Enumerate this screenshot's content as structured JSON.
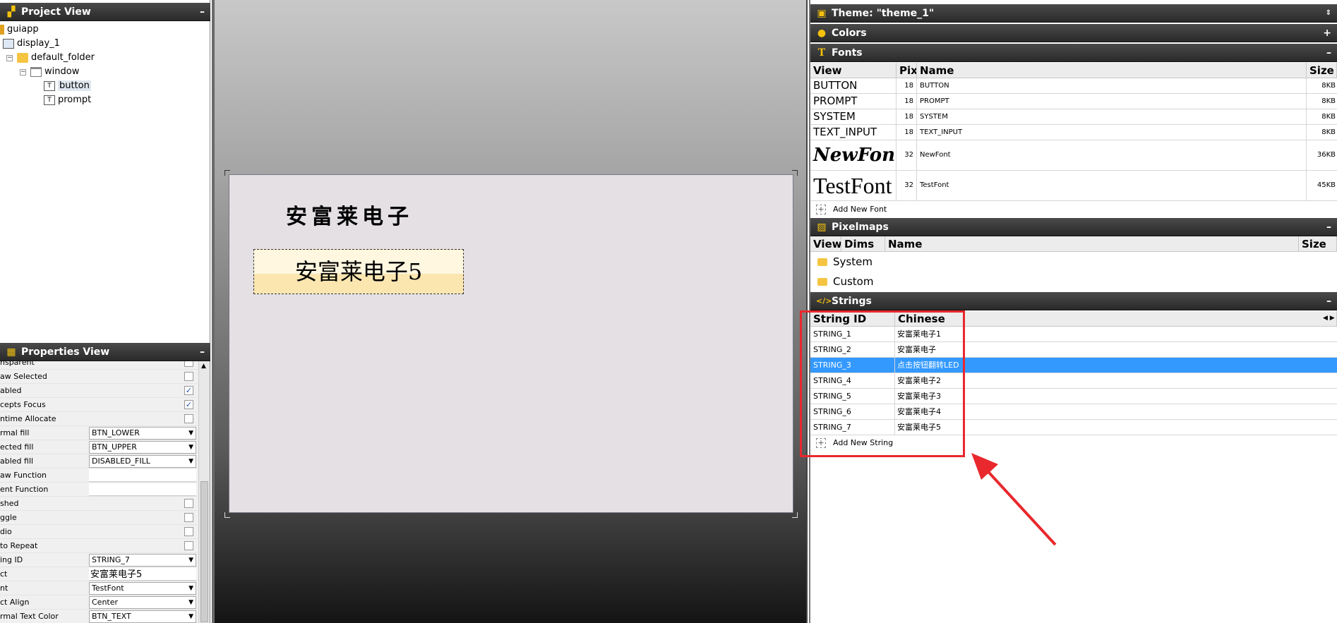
{
  "project_view": {
    "title": "Project View",
    "collapse": "–",
    "tree": [
      {
        "label": "guiapp"
      },
      {
        "label": "display_1"
      },
      {
        "label": "default_folder"
      },
      {
        "label": "window"
      },
      {
        "label": "button"
      },
      {
        "label": "prompt"
      }
    ]
  },
  "properties_view": {
    "title": "Properties View",
    "collapse": "–",
    "rows": [
      {
        "label": "nsparent",
        "type": "check",
        "checked": false
      },
      {
        "label": "aw Selected",
        "type": "check",
        "checked": false
      },
      {
        "label": "abled",
        "type": "check",
        "checked": true
      },
      {
        "label": "cepts Focus",
        "type": "check",
        "checked": true
      },
      {
        "label": "ntime Allocate",
        "type": "check",
        "checked": false
      },
      {
        "label": "rmal fill",
        "type": "combo",
        "value": "BTN_LOWER"
      },
      {
        "label": "ected fill",
        "type": "combo",
        "value": "BTN_UPPER"
      },
      {
        "label": "abled fill",
        "type": "combo",
        "value": "DISABLED_FILL"
      },
      {
        "label": "aw Function",
        "type": "text",
        "value": ""
      },
      {
        "label": "ent Function",
        "type": "text",
        "value": ""
      },
      {
        "label": "shed",
        "type": "check",
        "checked": false
      },
      {
        "label": "ggle",
        "type": "check",
        "checked": false
      },
      {
        "label": "dio",
        "type": "check",
        "checked": false
      },
      {
        "label": "to Repeat",
        "type": "check",
        "checked": false
      },
      {
        "label": "ing ID",
        "type": "combo",
        "value": "STRING_7"
      },
      {
        "label": "ct",
        "type": "text",
        "value": "安富莱电子5"
      },
      {
        "label": "nt",
        "type": "combo",
        "value": "TestFont"
      },
      {
        "label": "ct Align",
        "type": "combo",
        "value": "Center"
      },
      {
        "label": "rmal Text Color",
        "type": "combo",
        "value": "BTN_TEXT"
      }
    ]
  },
  "canvas": {
    "prompt_text": "安富莱电子",
    "button_text": "安富莱电子5"
  },
  "theme": {
    "title": "Theme: \"theme_1\"",
    "colors_title": "Colors",
    "colors_ctl": "+",
    "fonts_title": "Fonts",
    "fonts_ctl": "–",
    "fonts_headers": [
      "View",
      "Pix",
      "Name",
      "Size"
    ],
    "fonts": [
      {
        "view": "BUTTON",
        "pix": "18",
        "name": "BUTTON",
        "size": "8KB"
      },
      {
        "view": "PROMPT",
        "pix": "18",
        "name": "PROMPT",
        "size": "8KB"
      },
      {
        "view": "SYSTEM",
        "pix": "18",
        "name": "SYSTEM",
        "size": "8KB"
      },
      {
        "view": "TEXT_INPUT",
        "pix": "18",
        "name": "TEXT_INPUT",
        "size": "8KB"
      },
      {
        "view": "NewFont",
        "pix": "32",
        "name": "NewFont",
        "size": "36KB"
      },
      {
        "view": "TestFont",
        "pix": "32",
        "name": "TestFont",
        "size": "45KB"
      }
    ],
    "add_font": "Add New Font",
    "pixelmaps_title": "Pixelmaps",
    "pixelmaps_ctl": "–",
    "pixelmaps_headers": [
      "View",
      "Dims",
      "Name",
      "Size"
    ],
    "pixelmap_folders": [
      "System",
      "Custom"
    ],
    "strings_title": "Strings",
    "strings_ctl": "–",
    "strings_headers": [
      "String ID",
      "Chinese"
    ],
    "strings": [
      {
        "id": "STRING_1",
        "text": "安富莱电子1"
      },
      {
        "id": "STRING_2",
        "text": "安富莱电子"
      },
      {
        "id": "STRING_3",
        "text": "点击按钮翻转LED"
      },
      {
        "id": "STRING_4",
        "text": "安富莱电子2"
      },
      {
        "id": "STRING_5",
        "text": "安富莱电子3"
      },
      {
        "id": "STRING_6",
        "text": "安富莱电子4"
      },
      {
        "id": "STRING_7",
        "text": "安富莱电子5"
      }
    ],
    "selected_string_index": 2,
    "add_string": "Add New String"
  },
  "colors": {
    "header_dark": "#2a2a2a",
    "accent_yellow": "#f4c20d",
    "selection_blue": "#3399ff",
    "highlight_red": "#e8282d",
    "button_fill_upper": "#fff7e0",
    "button_fill_lower": "#fbe6b0"
  }
}
